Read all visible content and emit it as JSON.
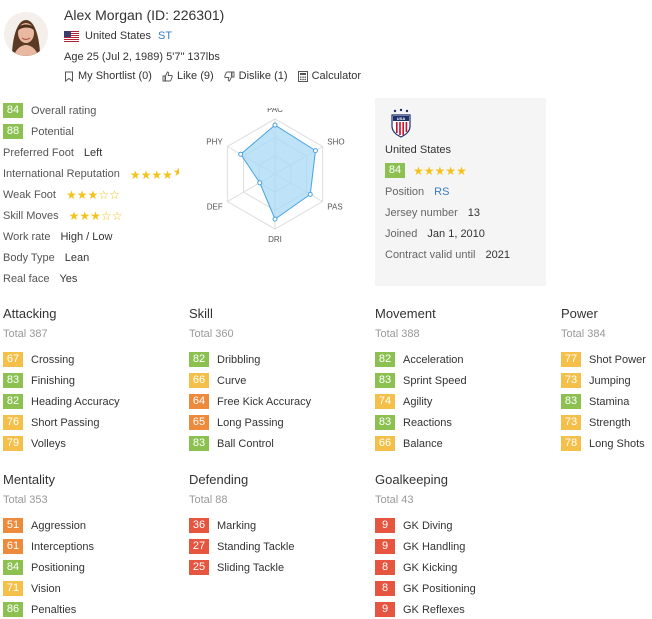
{
  "player": {
    "name": "Alex Morgan (ID: 226301)",
    "country": "United States",
    "position": "ST",
    "meta": "Age 25 (Jul 2, 1989) 5'7\" 137lbs"
  },
  "actions": [
    {
      "label": "My Shortlist (0)",
      "icon": "bookmark-icon"
    },
    {
      "label": "Like (9)",
      "icon": "thumbs-up-icon"
    },
    {
      "label": "Dislike (1)",
      "icon": "thumbs-down-icon"
    },
    {
      "label": "Calculator",
      "icon": "calculator-icon"
    }
  ],
  "info": {
    "overall": {
      "value": "84",
      "label": "Overall rating"
    },
    "potential": {
      "value": "88",
      "label": "Potential"
    },
    "preferred_foot": {
      "label": "Preferred Foot",
      "value": "Left"
    },
    "international_reputation": {
      "label": "International Reputation",
      "stars": 4.5
    },
    "weak_foot": {
      "label": "Weak Foot",
      "stars": 3
    },
    "skill_moves": {
      "label": "Skill Moves",
      "stars": 3
    },
    "work_rate": {
      "label": "Work rate",
      "value": "High / Low"
    },
    "body_type": {
      "label": "Body Type",
      "value": "Lean"
    },
    "real_face": {
      "label": "Real face",
      "value": "Yes"
    }
  },
  "radar": {
    "labels": [
      "PAC",
      "SHO",
      "PAS",
      "DRI",
      "DEF",
      "PHY"
    ],
    "values": [
      89,
      85,
      74,
      82,
      32,
      72
    ],
    "fill": "#a8d8f5",
    "stroke": "#4aa3df"
  },
  "team": {
    "name": "United States",
    "rating": "84",
    "stars": 5,
    "position_label": "Position",
    "position_value": "RS",
    "jersey_label": "Jersey number",
    "jersey_value": "13",
    "joined_label": "Joined",
    "joined_value": "Jan 1, 2010",
    "contract_label": "Contract valid until",
    "contract_value": "2021"
  },
  "sections": {
    "attacking": {
      "title": "Attacking",
      "total": "Total 387",
      "items": [
        {
          "v": "67",
          "n": "Crossing"
        },
        {
          "v": "83",
          "n": "Finishing"
        },
        {
          "v": "82",
          "n": "Heading Accuracy"
        },
        {
          "v": "76",
          "n": "Short Passing"
        },
        {
          "v": "79",
          "n": "Volleys"
        }
      ]
    },
    "skill": {
      "title": "Skill",
      "total": "Total 360",
      "items": [
        {
          "v": "82",
          "n": "Dribbling"
        },
        {
          "v": "66",
          "n": "Curve"
        },
        {
          "v": "64",
          "n": "Free Kick Accuracy"
        },
        {
          "v": "65",
          "n": "Long Passing"
        },
        {
          "v": "83",
          "n": "Ball Control"
        }
      ]
    },
    "movement": {
      "title": "Movement",
      "total": "Total 388",
      "items": [
        {
          "v": "82",
          "n": "Acceleration"
        },
        {
          "v": "83",
          "n": "Sprint Speed"
        },
        {
          "v": "74",
          "n": "Agility"
        },
        {
          "v": "83",
          "n": "Reactions"
        },
        {
          "v": "66",
          "n": "Balance"
        }
      ]
    },
    "power": {
      "title": "Power",
      "total": "Total 384",
      "items": [
        {
          "v": "77",
          "n": "Shot Power"
        },
        {
          "v": "73",
          "n": "Jumping"
        },
        {
          "v": "83",
          "n": "Stamina"
        },
        {
          "v": "73",
          "n": "Strength"
        },
        {
          "v": "78",
          "n": "Long Shots"
        }
      ]
    },
    "mentality": {
      "title": "Mentality",
      "total": "Total 353",
      "items": [
        {
          "v": "51",
          "n": "Aggression"
        },
        {
          "v": "61",
          "n": "Interceptions"
        },
        {
          "v": "84",
          "n": "Positioning"
        },
        {
          "v": "71",
          "n": "Vision"
        },
        {
          "v": "86",
          "n": "Penalties"
        }
      ]
    },
    "defending": {
      "title": "Defending",
      "total": "Total 88",
      "items": [
        {
          "v": "36",
          "n": "Marking"
        },
        {
          "v": "27",
          "n": "Standing Tackle"
        },
        {
          "v": "25",
          "n": "Sliding Tackle"
        }
      ]
    },
    "goalkeeping": {
      "title": "Goalkeeping",
      "total": "Total 43",
      "items": [
        {
          "v": "9",
          "n": "GK Diving"
        },
        {
          "v": "9",
          "n": "GK Handling"
        },
        {
          "v": "8",
          "n": "GK Kicking"
        },
        {
          "v": "8",
          "n": "GK Positioning"
        },
        {
          "v": "9",
          "n": "GK Reflexes"
        }
      ]
    }
  },
  "colors": {
    "green": "#8cc152",
    "yellow": "#f5c04a",
    "orange": "#ee8a3c",
    "red": "#e65540",
    "link": "#3a7dc1",
    "star": "#f4c31b"
  }
}
